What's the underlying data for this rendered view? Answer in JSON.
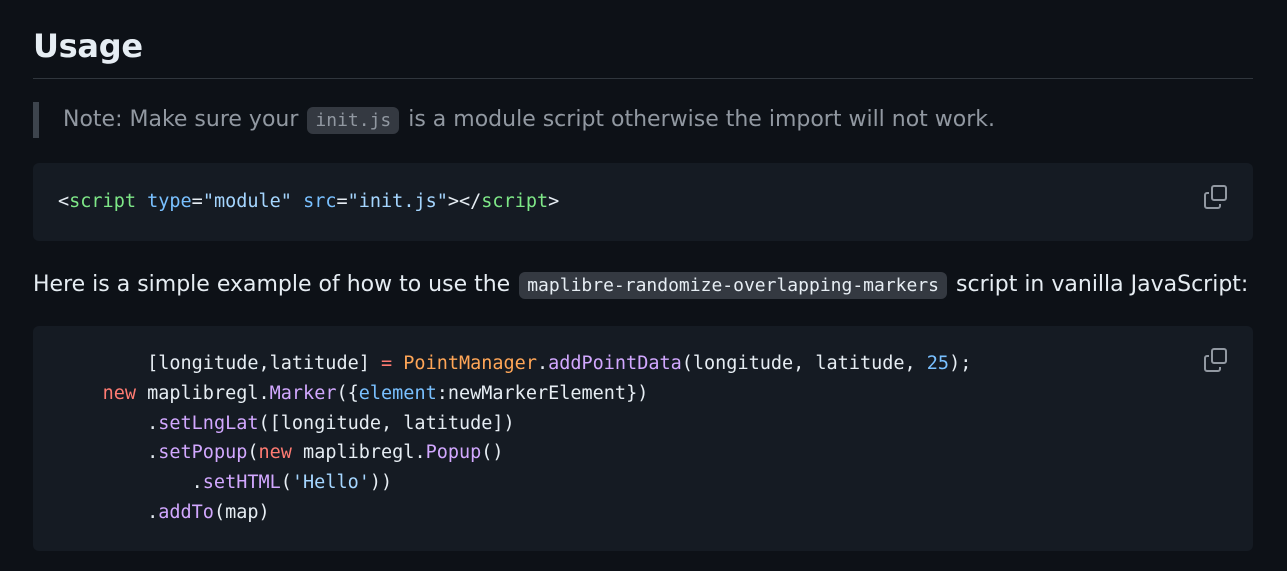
{
  "heading": "Usage",
  "note": {
    "before": "Note: Make sure your ",
    "code": "init.js",
    "after": " is a module script otherwise the import will not work."
  },
  "code_block_1": {
    "tokens": [
      {
        "t": "<",
        "c": ""
      },
      {
        "t": "script",
        "c": "t-tag"
      },
      {
        "t": " ",
        "c": ""
      },
      {
        "t": "type",
        "c": "t-attr"
      },
      {
        "t": "=",
        "c": ""
      },
      {
        "t": "\"module\"",
        "c": "t-str"
      },
      {
        "t": " ",
        "c": ""
      },
      {
        "t": "src",
        "c": "t-attr"
      },
      {
        "t": "=",
        "c": ""
      },
      {
        "t": "\"init.js\"",
        "c": "t-str"
      },
      {
        "t": "></",
        "c": ""
      },
      {
        "t": "script",
        "c": "t-tag"
      },
      {
        "t": ">",
        "c": ""
      }
    ]
  },
  "paragraph": {
    "before": "Here is a simple example of how to use the ",
    "code": "maplibre-randomize-overlapping-markers",
    "after": " script in vanilla JavaScript:"
  },
  "code_block_2": {
    "lines": [
      [
        {
          "t": "        [longitude,latitude] ",
          "c": ""
        },
        {
          "t": "=",
          "c": "t-kw"
        },
        {
          "t": " ",
          "c": ""
        },
        {
          "t": "PointManager",
          "c": "t-cls"
        },
        {
          "t": ".",
          "c": ""
        },
        {
          "t": "addPointData",
          "c": "t-fn"
        },
        {
          "t": "(longitude, latitude, ",
          "c": ""
        },
        {
          "t": "25",
          "c": "t-num"
        },
        {
          "t": ");",
          "c": ""
        }
      ],
      [
        {
          "t": "    ",
          "c": ""
        },
        {
          "t": "new",
          "c": "t-kw"
        },
        {
          "t": " maplibregl.",
          "c": ""
        },
        {
          "t": "Marker",
          "c": "t-fn"
        },
        {
          "t": "({",
          "c": ""
        },
        {
          "t": "element",
          "c": "t-prop"
        },
        {
          "t": ":newMarkerElement})",
          "c": ""
        }
      ],
      [
        {
          "t": "        .",
          "c": ""
        },
        {
          "t": "setLngLat",
          "c": "t-fn"
        },
        {
          "t": "([longitude, latitude])",
          "c": ""
        }
      ],
      [
        {
          "t": "        .",
          "c": ""
        },
        {
          "t": "setPopup",
          "c": "t-fn"
        },
        {
          "t": "(",
          "c": ""
        },
        {
          "t": "new",
          "c": "t-kw"
        },
        {
          "t": " maplibregl.",
          "c": ""
        },
        {
          "t": "Popup",
          "c": "t-fn"
        },
        {
          "t": "()",
          "c": ""
        }
      ],
      [
        {
          "t": "            .",
          "c": ""
        },
        {
          "t": "setHTML",
          "c": "t-fn"
        },
        {
          "t": "(",
          "c": ""
        },
        {
          "t": "'Hello'",
          "c": "t-str"
        },
        {
          "t": "))",
          "c": ""
        }
      ],
      [
        {
          "t": "        .",
          "c": ""
        },
        {
          "t": "addTo",
          "c": "t-fn"
        },
        {
          "t": "(map)",
          "c": ""
        }
      ]
    ]
  },
  "icons": {
    "copy": "copy-icon"
  }
}
